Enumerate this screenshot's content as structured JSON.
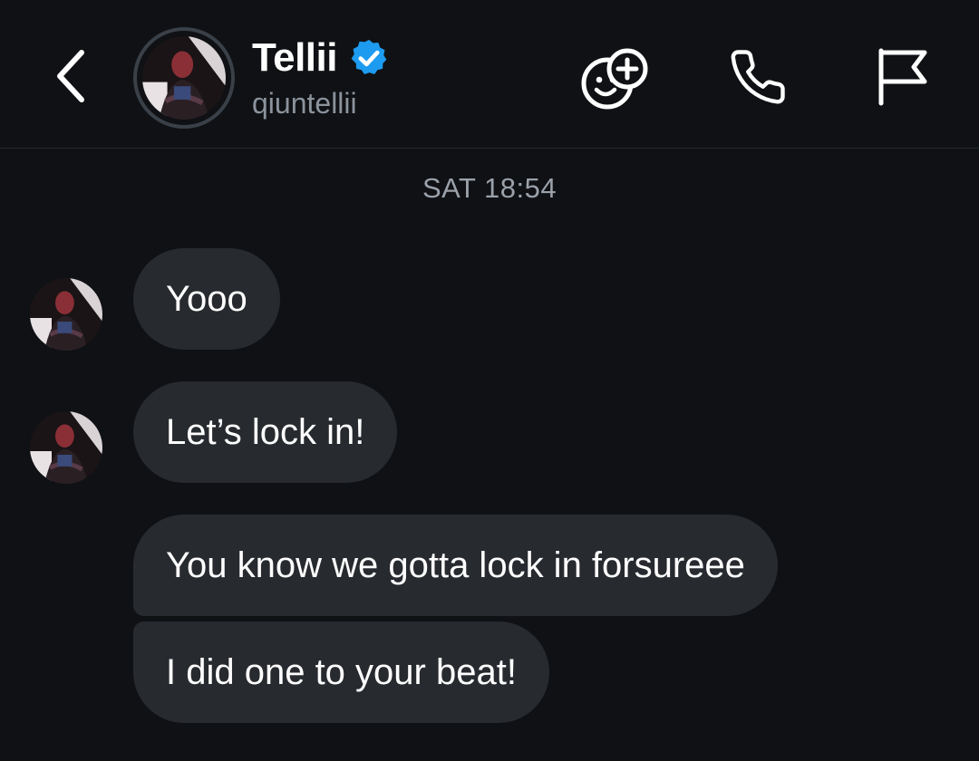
{
  "header": {
    "name": "Tellii",
    "handle": "qiuntellii",
    "verified": true,
    "icons": [
      "back-chevron-icon",
      "add-reaction-icon",
      "phone-icon",
      "flag-icon"
    ]
  },
  "thread": {
    "timestamp": "SAT 18:54",
    "messages": [
      {
        "text": "Yooo",
        "show_avatar": true
      },
      {
        "text": "Let’s lock in!",
        "show_avatar": true
      },
      {
        "text": "You know we gotta lock in forsureee",
        "show_avatar": false
      },
      {
        "text": "I did one to your beat!",
        "show_avatar": false
      }
    ]
  },
  "colors": {
    "background": "#0f1114",
    "bubble": "#272a2f",
    "verified_blue": "#1d9bf0",
    "muted_text": "#8b939d"
  }
}
